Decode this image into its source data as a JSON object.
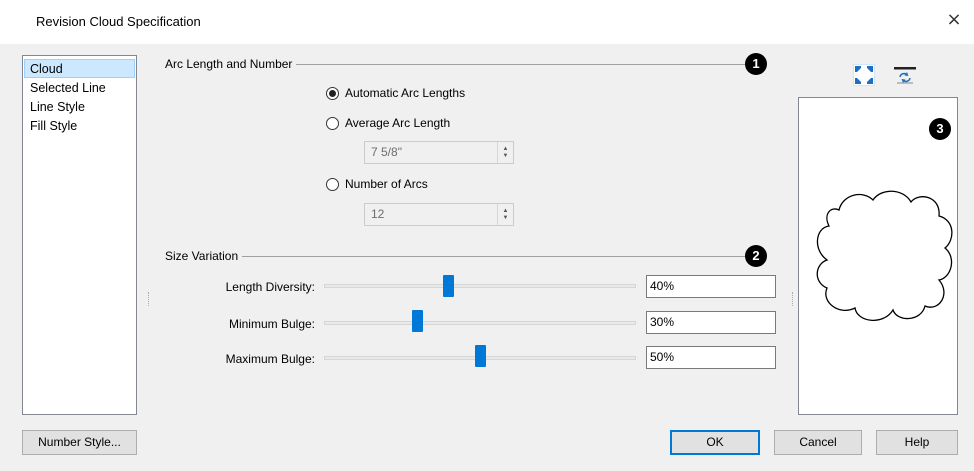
{
  "window": {
    "title": "Revision Cloud Specification",
    "close_glyph": "×"
  },
  "sidebar": {
    "items": [
      {
        "label": "Cloud",
        "active": true
      },
      {
        "label": "Selected Line"
      },
      {
        "label": "Line Style"
      },
      {
        "label": "Fill Style"
      }
    ]
  },
  "arc_section": {
    "title": "Arc Length and Number",
    "badge": "1",
    "automatic_label": "Automatic Arc Lengths",
    "average_label": "Average Arc Length",
    "average_value": "7 5/8\"",
    "number_label": "Number of Arcs",
    "number_value": "12",
    "selected": "automatic"
  },
  "size_section": {
    "title": "Size Variation",
    "badge": "2",
    "sliders": [
      {
        "label": "Length Diversity:",
        "value": "40%",
        "level": 0.4
      },
      {
        "label": "Minimum Bulge:",
        "value": "30%",
        "level": 0.3
      },
      {
        "label": "Maximum Bulge:",
        "value": "50%",
        "level": 0.5
      }
    ]
  },
  "preview": {
    "badge": "3",
    "icons": [
      "fill-window-icon",
      "reset-view-icon"
    ]
  },
  "footer": {
    "number_style_label": "Number Style...",
    "ok_label": "OK",
    "cancel_label": "Cancel",
    "help_label": "Help"
  },
  "colors": {
    "accent": "#0078d7",
    "selection": "#cce8ff"
  }
}
